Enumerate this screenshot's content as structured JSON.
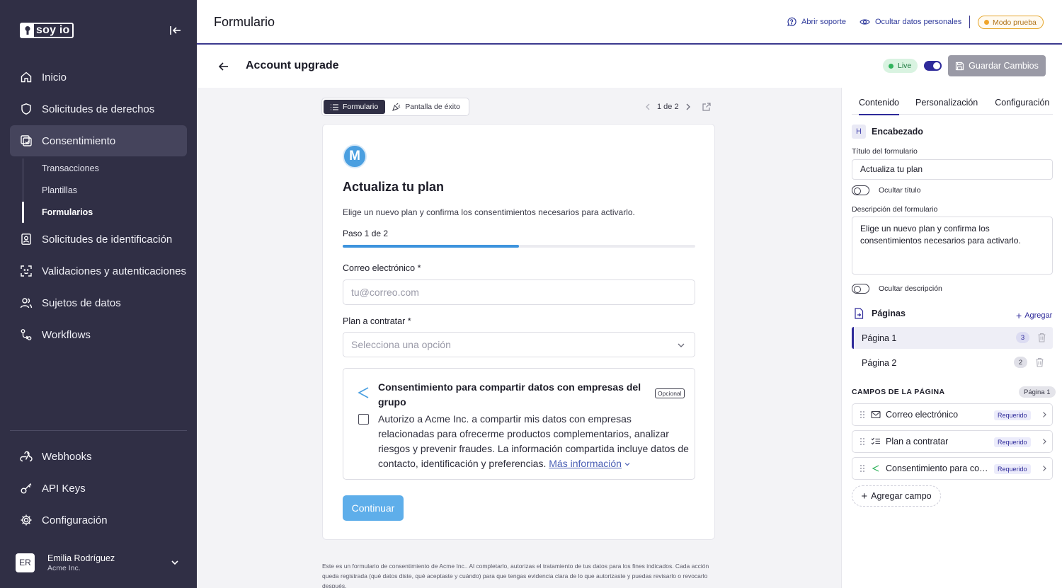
{
  "brand": {
    "logo_text": "soy io"
  },
  "sidebar": {
    "items": [
      {
        "label": "Inicio",
        "icon": "home-icon"
      },
      {
        "label": "Solicitudes de derechos",
        "icon": "shield-icon"
      },
      {
        "label": "Consentimiento",
        "icon": "consent-icon"
      },
      {
        "label": "Solicitudes de identificación",
        "icon": "id-badge-icon"
      },
      {
        "label": "Validaciones y autenticaciones",
        "icon": "face-scan-icon"
      },
      {
        "label": "Sujetos de datos",
        "icon": "users-icon"
      },
      {
        "label": "Workflows",
        "icon": "workflow-icon"
      }
    ],
    "subitems": [
      "Transacciones",
      "Plantillas",
      "Formularios"
    ],
    "bottom_items": [
      {
        "label": "Webhooks",
        "icon": "webhook-icon"
      },
      {
        "label": "API Keys",
        "icon": "key-icon"
      },
      {
        "label": "Configuración",
        "icon": "gear-icon"
      }
    ],
    "user": {
      "initials": "ER",
      "name": "Emilia Rodríguez",
      "org": "Acme Inc."
    }
  },
  "topbar": {
    "title": "Formulario",
    "support_label": "Abrir soporte",
    "hide_data_label": "Ocultar datos personales",
    "mode_label": "Modo prueba"
  },
  "page_header": {
    "title": "Account upgrade",
    "status": "Live",
    "save_label": "Guardar Cambios"
  },
  "preview": {
    "view_tabs": [
      "Formulario",
      "Pantalla de éxito"
    ],
    "page_indicator": "1 de 2",
    "form": {
      "brand_initial": "M",
      "title": "Actualiza tu plan",
      "description": "Elige un nuevo plan y confirma los consentimientos necesarios para activarlo.",
      "step_label": "Paso 1 de 2",
      "progress": 0.5,
      "email_label": "Correo electrónico *",
      "email_placeholder": "tu@correo.com",
      "plan_label": "Plan a contratar *",
      "plan_placeholder": "Selecciona una opción",
      "consent": {
        "title": "Consentimiento para compartir datos con empresas del grupo",
        "optional_badge": "Opcional",
        "text": "Autorizo a Acme Inc. a compartir mis datos con empresas relacionadas para ofrecerme productos complementarios, analizar riesgos y prevenir fraudes. La información compartida incluye datos de contacto, identificación y preferencias.",
        "more_link": "Más información"
      },
      "continue_label": "Continuar"
    },
    "footnote": "Este es un formulario de consentimiento de Acme Inc.. Al completarlo, autorizas el tratamiento de tus datos para los fines indicados. Cada acción queda registrada (qué datos diste, qué aceptaste y cuándo) para que tengas evidencia clara de lo que autorizaste y puedas revisarlo o revocarlo después."
  },
  "right_panel": {
    "tabs": [
      "Contenido",
      "Personalización",
      "Configuración"
    ],
    "header_section": {
      "badge": "H",
      "title": "Encabezado",
      "title_field_label": "Título del formulario",
      "title_value": "Actualiza tu plan",
      "hide_title_label": "Ocultar título",
      "desc_field_label": "Descripción del formulario",
      "desc_value": "Elige un nuevo plan y confirma los consentimientos necesarios para activarlo.",
      "hide_desc_label": "Ocultar descripción"
    },
    "pages_section": {
      "title": "Páginas",
      "add_label": "Agregar",
      "pages": [
        {
          "name": "Página 1",
          "count": "3"
        },
        {
          "name": "Página 2",
          "count": "2"
        }
      ]
    },
    "fields_section": {
      "title": "CAMPOS DE LA PÁGINA",
      "page_badge": "Página 1",
      "fields": [
        {
          "name": "Correo electrónico",
          "badge": "Requerido",
          "icon": "mail-icon"
        },
        {
          "name": "Plan a contratar",
          "badge": "Requerido",
          "icon": "checklist-icon"
        },
        {
          "name": "Consentimiento para compartir datos con empresas del grupo",
          "badge": "Requerido",
          "icon": "share-icon"
        }
      ],
      "add_field_label": "Agregar campo"
    }
  },
  "colors": {
    "sidebar_bg": "#302f45",
    "accent": "#2e2a9a",
    "form_primary": "#4a9fe0",
    "live_green": "#2fb35b",
    "test_mode_orange": "#f0a52a"
  }
}
